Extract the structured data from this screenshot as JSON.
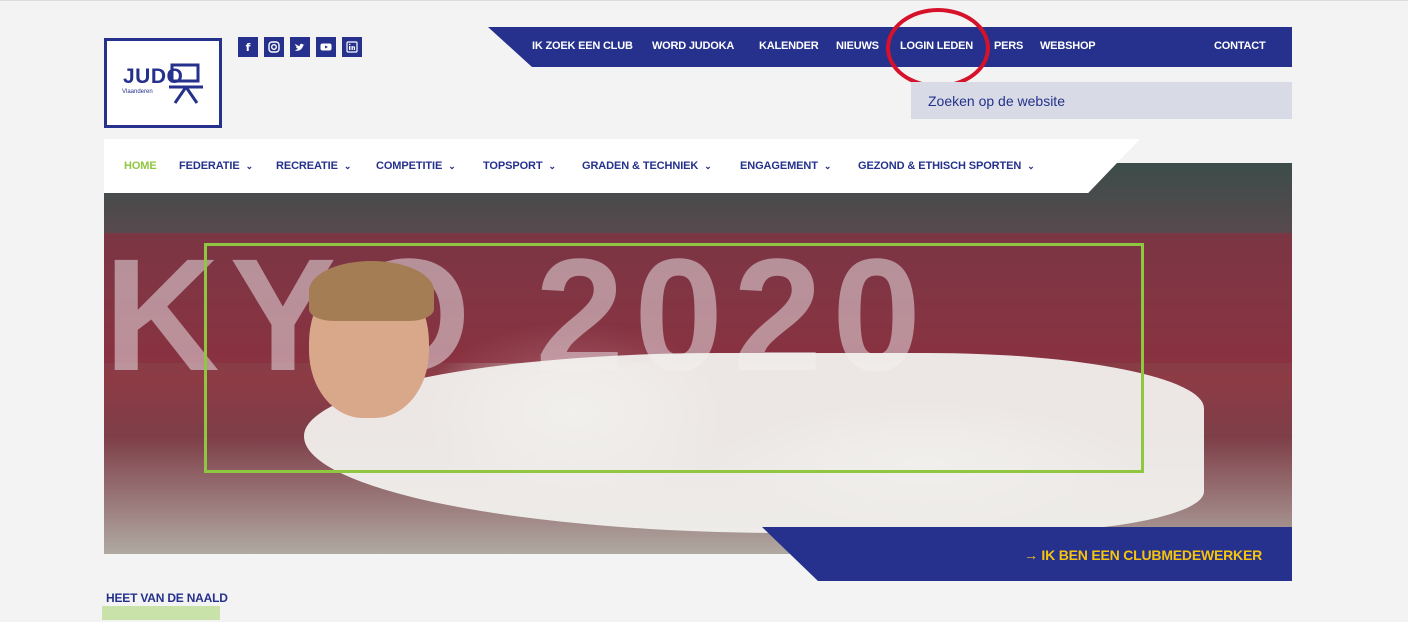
{
  "logo": {
    "text": "JUDO",
    "subtitle": "Vlaanderen"
  },
  "social": [
    {
      "name": "facebook-icon",
      "glyph": "f"
    },
    {
      "name": "instagram-icon",
      "glyph": "◎"
    },
    {
      "name": "twitter-icon",
      "glyph": "t"
    },
    {
      "name": "youtube-icon",
      "glyph": "▶"
    },
    {
      "name": "linkedin-icon",
      "glyph": "in"
    }
  ],
  "topnav": {
    "items": [
      "IK ZOEK EEN CLUB",
      "WORD JUDOKA",
      "KALENDER",
      "NIEUWS",
      "LOGIN LEDEN",
      "PERS",
      "WEBSHOP"
    ],
    "contact": "CONTACT"
  },
  "search": {
    "placeholder": "Zoeken op de website"
  },
  "mainnav": {
    "items": [
      "HOME",
      "FEDERATIE",
      "RECREATIE",
      "COMPETITIE",
      "TOPSPORT",
      "GRADEN & TECHNIEK",
      "ENGAGEMENT",
      "GEZOND & ETHISCH SPORTEN"
    ]
  },
  "hero": {
    "cta": "→ IK BEN EEN CLUBMEDEWERKER"
  },
  "section": {
    "heading": "HEET VAN DE NAALD"
  },
  "colors": {
    "brand": "#25318c",
    "accent": "#8fc741",
    "cta_text": "#f7c40c",
    "highlight": "#d6112a"
  }
}
